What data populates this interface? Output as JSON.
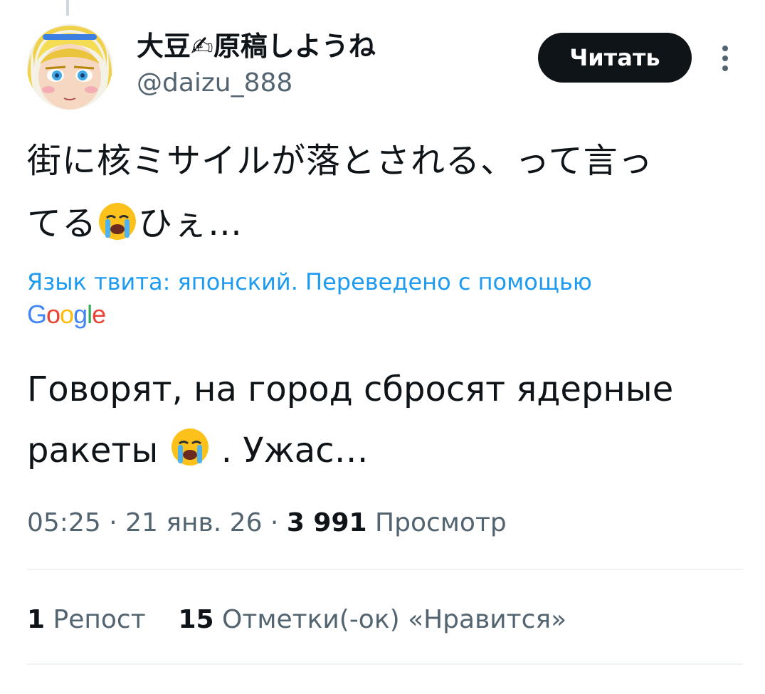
{
  "author": {
    "display_name": "大豆✍原稿しようね",
    "handle": "@daizu_888"
  },
  "follow_button": {
    "label": "Читать"
  },
  "tweet": {
    "text_line1": "街に核ミサイルが落とされる、って言っ",
    "text_line2_start": "てる",
    "text_line2_end": "ひぇ…",
    "translation_note": "Язык твита: японский. Переведено с помощью",
    "translator": "Google",
    "translated_line1": "Говорят, на город сбросят ядерные",
    "translated_line2_start": "ракеты",
    "translated_line2_end": ". Ужас…"
  },
  "meta": {
    "time": "05:25",
    "date": "21 янв. 26",
    "views_count": "3 991",
    "views_label": "Просмотр",
    "separator": "·"
  },
  "stats": {
    "reposts_count": "1",
    "reposts_label": "Репост",
    "likes_count": "15",
    "likes_label": "Отметки(-ок) «Нравится»"
  },
  "icons": {
    "emoji": "loudly-crying-face-emoji",
    "more": "more-vertical-icon"
  },
  "colors": {
    "link_blue": "#1d9bf0",
    "text_primary": "#0f1419",
    "text_secondary": "#536471",
    "button_bg": "#0f1419",
    "google_blue": "#4285f4",
    "google_red": "#ea4335",
    "google_yellow": "#fbbc05",
    "google_green": "#34a853"
  }
}
